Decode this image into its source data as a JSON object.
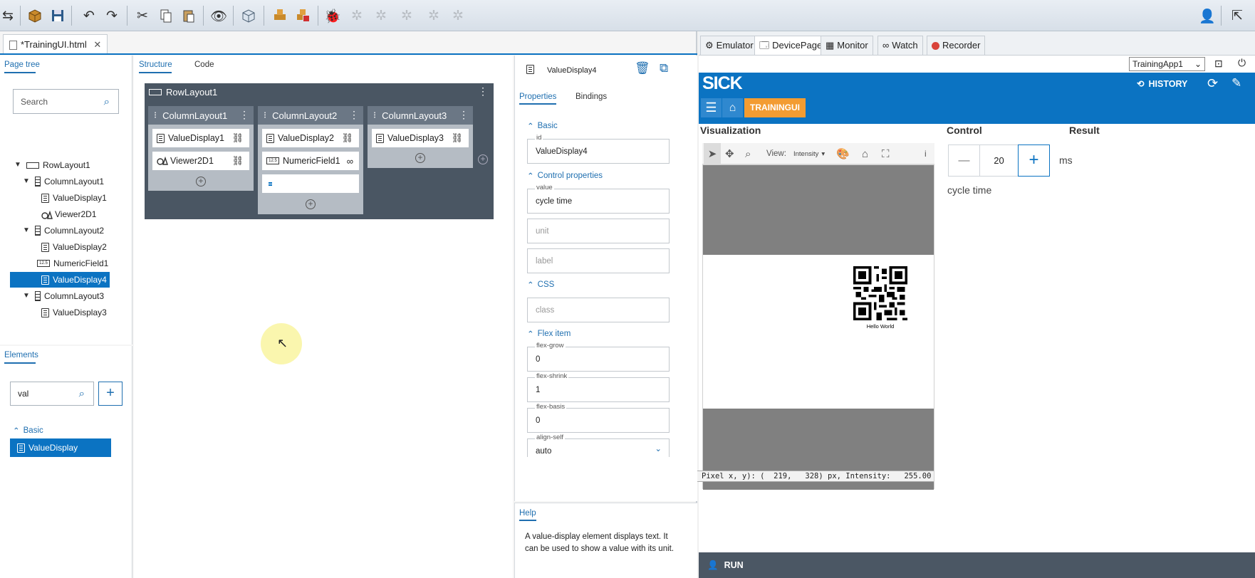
{
  "toolbar": {
    "icons": [
      "sync-icon",
      "package-icon",
      "save-icon",
      "undo-icon",
      "redo-icon",
      "cut-icon",
      "copy-icon",
      "paste-icon",
      "preview-icon",
      "cube-icon",
      "deploy-icon",
      "stop-deploy-icon",
      "debug-icon",
      "step-icon",
      "step-into-icon",
      "step-over-icon",
      "step-out-icon",
      "debug-stop-icon",
      "user-icon",
      "export-icon"
    ]
  },
  "editor": {
    "file_tab": "*TrainingUI.html",
    "page_tree": {
      "title": "Page tree",
      "search_placeholder": "Search",
      "items": [
        {
          "label": "RowLayout1"
        },
        {
          "label": "ColumnLayout1"
        },
        {
          "label": "ValueDisplay1"
        },
        {
          "label": "Viewer2D1"
        },
        {
          "label": "ColumnLayout2"
        },
        {
          "label": "ValueDisplay2"
        },
        {
          "label": "NumericField1"
        },
        {
          "label": "ValueDisplay4"
        },
        {
          "label": "ColumnLayout3"
        },
        {
          "label": "ValueDisplay3"
        }
      ]
    },
    "elements": {
      "title": "Elements",
      "search_value": "val",
      "add_label": "+",
      "group": "Basic",
      "item": "ValueDisplay"
    },
    "canvas_tabs": {
      "structure": "Structure",
      "code": "Code"
    },
    "structure": {
      "row": "RowLayout1",
      "columns": [
        {
          "title": "ColumnLayout1",
          "items": [
            "ValueDisplay1",
            "Viewer2D1"
          ]
        },
        {
          "title": "ColumnLayout2",
          "items": [
            "ValueDisplay2",
            "NumericField1",
            "ValueDisplay4"
          ]
        },
        {
          "title": "ColumnLayout3",
          "items": [
            "ValueDisplay3"
          ]
        }
      ]
    },
    "props": {
      "element": "ValueDisplay4",
      "tab_properties": "Properties",
      "tab_bindings": "Bindings",
      "sec_basic": "Basic",
      "id_label": "id",
      "id_value": "ValueDisplay4",
      "sec_control": "Control properties",
      "value_label": "value",
      "value_value": "cycle time",
      "unit_placeholder": "unit",
      "label_placeholder": "label",
      "sec_css": "CSS",
      "class_placeholder": "class",
      "sec_flex": "Flex item",
      "flex_grow_label": "flex-grow",
      "flex_grow": "0",
      "flex_shrink_label": "flex-shrink",
      "flex_shrink": "1",
      "flex_basis_label": "flex-basis",
      "flex_basis": "0",
      "align_self_label": "align-self",
      "align_self": "auto"
    },
    "help": {
      "title": "Help",
      "text": "A value-display element displays text. It can be used to show a value with its unit."
    }
  },
  "right": {
    "tabs": [
      "Emulator",
      "DevicePage",
      "Monitor",
      "Watch",
      "Recorder"
    ],
    "app_select": "TrainingApp1",
    "brand": "SICK",
    "history": "HISTORY",
    "nav_page": "TRAININGUI",
    "visualization": "Visualization",
    "control": "Control",
    "result": "Result",
    "view_label": "View:",
    "view_mode": "Intensity",
    "info": "i",
    "qr_caption": "Hello World",
    "pixel_readout": "Pixel x, y): (  219,   328) px, Intensity:   255.00",
    "stepper_minus": "—",
    "stepper_value": "20",
    "stepper_plus": "+",
    "stepper_unit": "ms",
    "cycle_time": "cycle time",
    "run": "RUN",
    "colors": {
      "sick_blue": "#0b73c2",
      "nav_orange": "#f39c32"
    }
  }
}
